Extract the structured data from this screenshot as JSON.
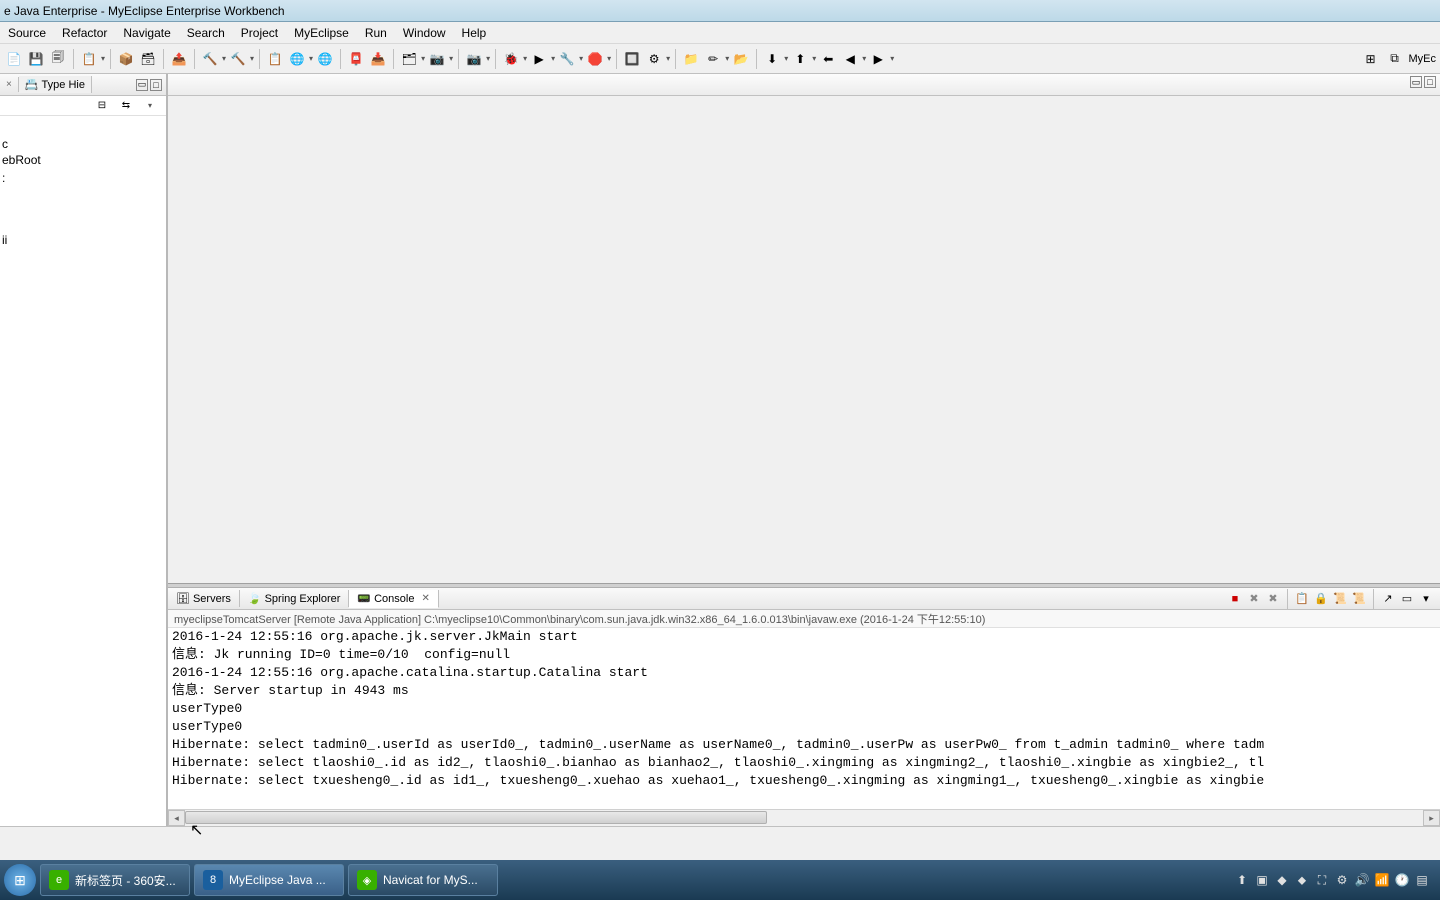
{
  "title": "e Java Enterprise - MyEclipse Enterprise Workbench",
  "menu": [
    "Source",
    "Refactor",
    "Navigate",
    "Search",
    "Project",
    "MyEclipse",
    "Run",
    "Window",
    "Help"
  ],
  "perspective_label": "MyEc",
  "sidebar": {
    "tab1_close": "×",
    "tab2_icon": "📇",
    "tab2_label": "Type Hie",
    "minimize": "▭",
    "maximize": "□",
    "tree": [
      "c",
      "ebRoot",
      "",
      ":",
      "",
      "",
      "",
      "ii"
    ]
  },
  "bottom": {
    "tabs": [
      {
        "icon": "🗄",
        "label": "Servers"
      },
      {
        "icon": "🍃",
        "label": "Spring Explorer"
      },
      {
        "icon": "📟",
        "label": "Console"
      }
    ],
    "close_x": "✕",
    "launch": "myeclipseTomcatServer [Remote Java Application] C:\\myeclipse10\\Common\\binary\\com.sun.java.jdk.win32.x86_64_1.6.0.013\\bin\\javaw.exe (2016-1-24 下午12:55:10)",
    "console_lines": [
      "2016-1-24 12:55:16 org.apache.jk.server.JkMain start",
      "信息: Jk running ID=0 time=0/10  config=null",
      "2016-1-24 12:55:16 org.apache.catalina.startup.Catalina start",
      "信息: Server startup in 4943 ms",
      "userType0",
      "userType0",
      "Hibernate: select tadmin0_.userId as userId0_, tadmin0_.userName as userName0_, tadmin0_.userPw as userPw0_ from t_admin tadmin0_ where tadm",
      "Hibernate: select tlaoshi0_.id as id2_, tlaoshi0_.bianhao as bianhao2_, tlaoshi0_.xingming as xingming2_, tlaoshi0_.xingbie as xingbie2_, tl",
      "Hibernate: select txuesheng0_.id as id1_, txuesheng0_.xuehao as xuehao1_, txuesheng0_.xingming as xingming1_, txuesheng0_.xingbie as xingbie"
    ]
  },
  "taskbar": {
    "items": [
      {
        "icon_bg": "#38b000",
        "icon_text": "e",
        "label": "新标签页 - 360安..."
      },
      {
        "icon_bg": "#1a5f9e",
        "icon_text": "8",
        "label": "MyEclipse Java ..."
      },
      {
        "icon_bg": "#38b000",
        "icon_text": "◈",
        "label": "Navicat for MyS..."
      }
    ]
  },
  "toolbar_icons": [
    "📄",
    "💾",
    "🗐",
    "|",
    "📋",
    "▾",
    "|",
    "📦",
    "🗃",
    "|",
    "📤",
    "|",
    "🔨",
    "▾",
    "🔨",
    "▾",
    "|",
    "📋",
    "🌐",
    "▾",
    "🌐",
    "|",
    "📮",
    "📥",
    "|",
    "🗂",
    "▾",
    "📷",
    "▾",
    "|",
    "📷",
    "▾",
    "|",
    "🐞",
    "▾",
    "▶",
    "▾",
    "🔧",
    "▾",
    "🛑",
    "▾",
    "|",
    "🔲",
    "⚙",
    "▾",
    "|",
    "📁",
    "✏",
    "▾",
    "📂",
    "|",
    "⬇",
    "▾",
    "⬆",
    "▾",
    "⬅",
    "◀",
    "▾",
    "▶",
    "▾"
  ],
  "console_tools": [
    "■",
    "✖",
    "✖",
    "|",
    "📋",
    "🔒",
    "📜",
    "📜",
    "|",
    "↗",
    "▭",
    "▾"
  ],
  "tray_icons": [
    "⬆",
    "▣",
    "◆",
    "⬥",
    "⛶",
    "⚙",
    "🔊",
    "📶",
    "🕐",
    "▤"
  ]
}
